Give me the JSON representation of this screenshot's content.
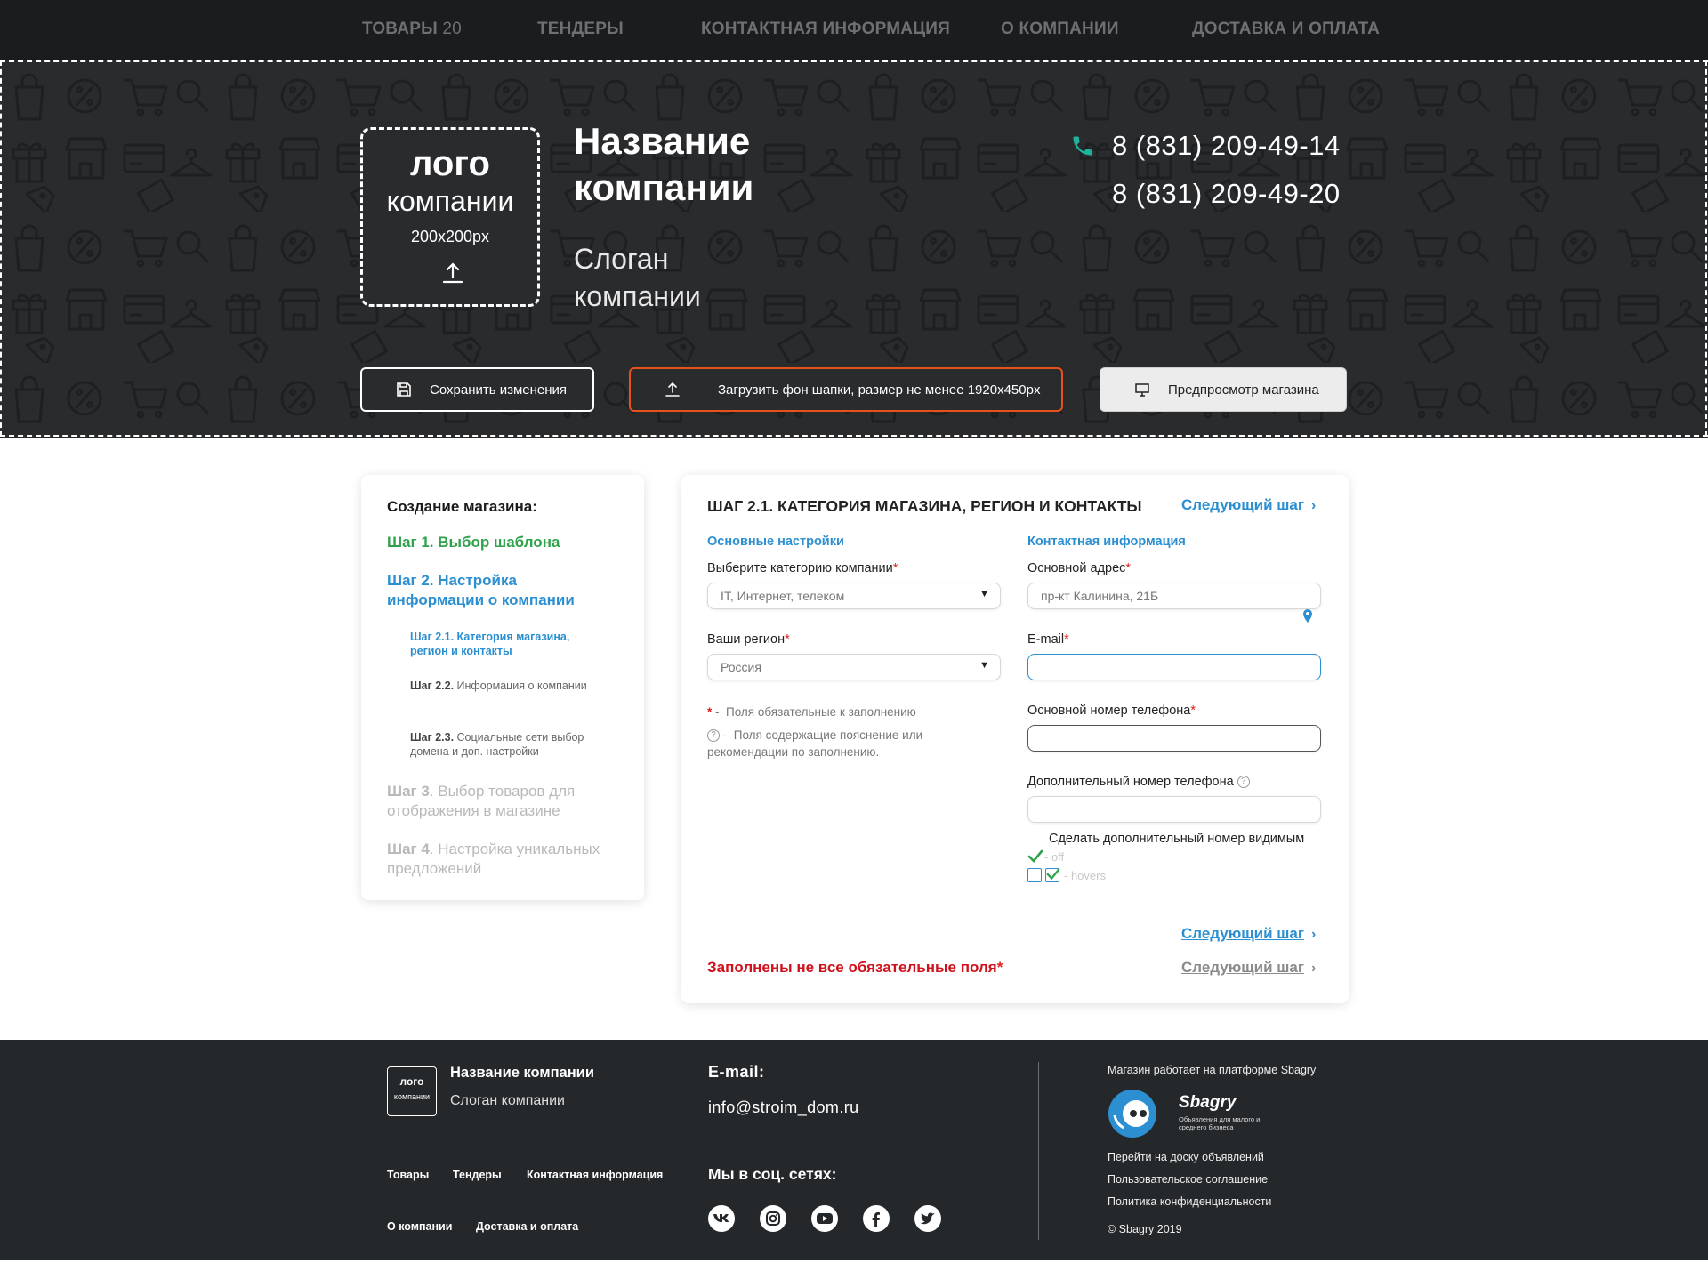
{
  "nav": {
    "items": [
      {
        "label": "Товары",
        "count": "20"
      },
      {
        "label": "Тендеры"
      },
      {
        "label": "Контактная информация"
      },
      {
        "label": "О компании"
      },
      {
        "label": "Доставка и оплата"
      }
    ]
  },
  "hero": {
    "logo_line1": "лого",
    "logo_line2": "компании",
    "logo_size": "200x200px",
    "company_name": "Название компании",
    "slogan": "Слоган компании",
    "phones": [
      "8 (831) 209-49-14",
      "8 (831) 209-49-20"
    ],
    "save_button": "Сохранить изменения",
    "upload_button": "Загрузить фон шапки, размер не менее 1920x450px",
    "preview_button": "Предпросмотр магазина",
    "colors": {
      "background": "#2a2b2d",
      "accent_orange": "#e8501c",
      "phone_icon": "#1fb39b"
    }
  },
  "sidebar": {
    "title": "Создание магазина:",
    "step1": "Шаг 1. Выбор шаблона",
    "step2": "Шаг 2. Настройка информации о компании",
    "sub1_bold": "Шаг 2.1.",
    "sub1_text": "Категория магазина, регион и контакты",
    "sub2_bold": "Шаг 2.2.",
    "sub2_text": "Информация о компании",
    "sub3_bold": "Шаг 2.3.",
    "sub3_text": "Социальные сети выбор домена и доп. настройки",
    "step3_bold": "Шаг 3",
    "step3_text": ". Выбор товаров для отображения в магазине",
    "step4_bold": "Шаг 4",
    "step4_text": ". Настройка уникальных предложений",
    "colors": {
      "done": "#2fa24b",
      "active": "#2b8fd1",
      "inactive": "#b9b9b9"
    }
  },
  "form": {
    "title": "Шаг 2.1. Категория магазина, регион и контакты",
    "next_label": "Следующий шаг",
    "section_basic": "Основные настройки",
    "section_contact": "Контактная информация",
    "category_label": "Выберите категорию компании",
    "category_value": "IT, Интернет, телеком",
    "region_label": "Ваши регион",
    "region_value": "Россия",
    "address_label": "Основной адрес",
    "address_placeholder": "пр-кт Калинина, 21Б",
    "email_label": "E-mail",
    "phone_label": "Основной номер телефона",
    "extra_phone_label": "Дополнительный номер телефона",
    "visible_label": "Сделать дополнительный номер видимым",
    "state_off": "- off",
    "state_hovers": "- hovers",
    "required_star": "*",
    "note_required": "Поля обязательные к заполнению",
    "note_hint": "Поля содержащие пояснение или рекомендации по заполнению.",
    "error_text": "Заполнены не все обязательные поля",
    "colors": {
      "link": "#2b8fd1",
      "error": "#d0101a",
      "required": "#e02020"
    }
  },
  "footer": {
    "logo_line1": "лого",
    "logo_line2": "компании",
    "company_name": "Название компании",
    "slogan": "Слоган компании",
    "links": [
      "Товары",
      "Тендеры",
      "Контактная информация",
      "О компании",
      "Доставка и оплата"
    ],
    "email_heading": "E-mail:",
    "email": "info@stroim_dom.ru",
    "social_heading": "Мы в соц. сетях:",
    "social_icons": [
      "vk-icon",
      "instagram-icon",
      "youtube-icon",
      "facebook-icon",
      "twitter-icon"
    ],
    "platform_text": "Магазин работает на платформе Sbagry",
    "brand_name": "Sbagry",
    "brand_tagline": "Объявления для малого и среднего бизнеса",
    "board_link": "Перейти на доску объявлений",
    "agreement": "Пользовательское соглашение",
    "privacy": "Политика конфиденциальности",
    "copyright": "© Sbagry 2019",
    "colors": {
      "background": "#24282b",
      "brand_blue": "#2b8fd1"
    }
  }
}
